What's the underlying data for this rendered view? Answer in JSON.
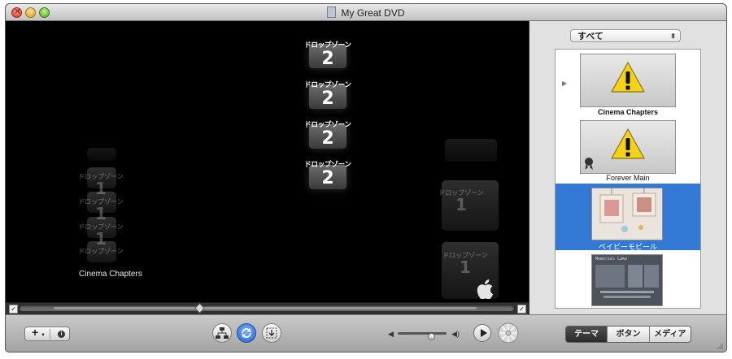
{
  "window": {
    "title": "My Great DVD"
  },
  "stage": {
    "drop_zone_label": "ドロップゾーン",
    "drop_zone_number": "2",
    "ghost_label": "ドロップゾーン",
    "ghost_number": "1",
    "menu_title": "Cinema Chapters"
  },
  "sidebar": {
    "filter_value": "すべて",
    "themes": [
      {
        "name": "Cinema Chapters",
        "selected": false
      },
      {
        "name": "Forever Main",
        "selected": false
      },
      {
        "name": "ベイビーモビール",
        "selected": true
      },
      {
        "name": "",
        "selected": false
      }
    ],
    "thumb4_caption": "Memories Lake"
  },
  "toolbar": {
    "add_label": "+",
    "info_label": "i",
    "tabs": [
      {
        "label": "テーマ",
        "active": true
      },
      {
        "label": "ボタン",
        "active": false
      },
      {
        "label": "メディア",
        "active": false
      }
    ]
  },
  "colors": {
    "selection": "#3478d6",
    "tab_active": "#333333"
  }
}
